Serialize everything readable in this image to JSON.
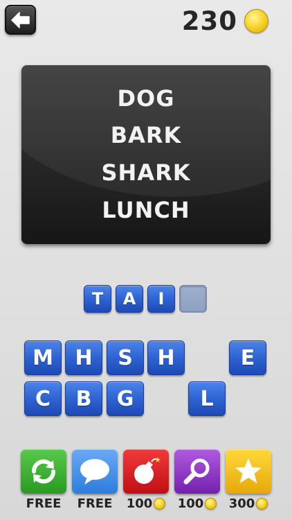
{
  "header": {
    "back_icon": "back-arrow-icon",
    "coins": "230",
    "coin_icon": "gold-coin-icon"
  },
  "clues": [
    "DOG",
    "BARK",
    "SHARK",
    "LUNCH"
  ],
  "answer": {
    "letters": [
      "T",
      "A",
      "I",
      ""
    ]
  },
  "keyboard": {
    "row1": [
      "M",
      "H",
      "S",
      "H",
      "E"
    ],
    "row2": [
      "C",
      "B",
      "G",
      "L"
    ]
  },
  "powerups": [
    {
      "name": "shuffle",
      "icon": "refresh-arrows-icon",
      "label": "FREE",
      "color": "#2fa32a"
    },
    {
      "name": "ask",
      "icon": "speech-bubble-icon",
      "label": "FREE",
      "color": "#3b8de8"
    },
    {
      "name": "bomb",
      "icon": "bomb-icon",
      "label": "100",
      "color": "#d8171b"
    },
    {
      "name": "reveal",
      "icon": "magnifier-icon",
      "label": "100",
      "color": "#8a2fc4"
    },
    {
      "name": "solve",
      "icon": "star-icon",
      "label": "300",
      "color": "#f2b910"
    }
  ]
}
